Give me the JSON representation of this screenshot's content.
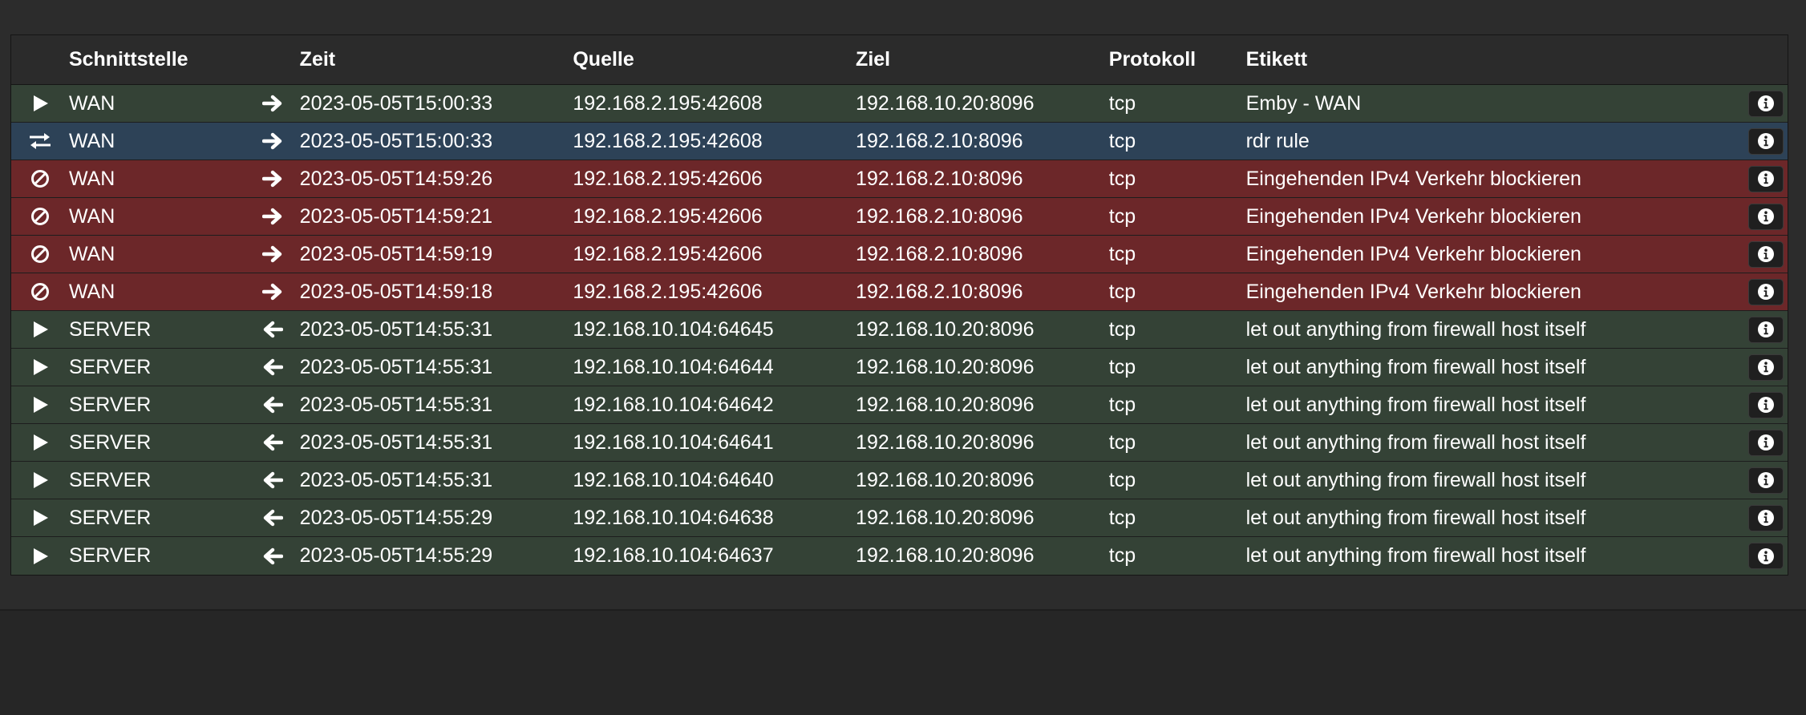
{
  "columns": {
    "interface": "Schnittstelle",
    "time": "Zeit",
    "source": "Quelle",
    "destination": "Ziel",
    "protocol": "Protokoll",
    "label": "Etikett"
  },
  "colors": {
    "pass": "#344236",
    "rdr": "#2d4257",
    "block": "#6c2729"
  },
  "rows": [
    {
      "action": "pass",
      "action_icon": "play-icon",
      "interface": "WAN",
      "direction": "in",
      "direction_icon": "arrow-right-icon",
      "time": "2023-05-05T15:00:33",
      "source": "192.168.2.195:42608",
      "destination": "192.168.10.20:8096",
      "protocol": "tcp",
      "label": "Emby - WAN"
    },
    {
      "action": "rdr",
      "action_icon": "exchange-icon",
      "interface": "WAN",
      "direction": "in",
      "direction_icon": "arrow-right-icon",
      "time": "2023-05-05T15:00:33",
      "source": "192.168.2.195:42608",
      "destination": "192.168.2.10:8096",
      "protocol": "tcp",
      "label": "rdr rule"
    },
    {
      "action": "block",
      "action_icon": "ban-icon",
      "interface": "WAN",
      "direction": "in",
      "direction_icon": "arrow-right-icon",
      "time": "2023-05-05T14:59:26",
      "source": "192.168.2.195:42606",
      "destination": "192.168.2.10:8096",
      "protocol": "tcp",
      "label": "Eingehenden IPv4 Verkehr blockieren"
    },
    {
      "action": "block",
      "action_icon": "ban-icon",
      "interface": "WAN",
      "direction": "in",
      "direction_icon": "arrow-right-icon",
      "time": "2023-05-05T14:59:21",
      "source": "192.168.2.195:42606",
      "destination": "192.168.2.10:8096",
      "protocol": "tcp",
      "label": "Eingehenden IPv4 Verkehr blockieren"
    },
    {
      "action": "block",
      "action_icon": "ban-icon",
      "interface": "WAN",
      "direction": "in",
      "direction_icon": "arrow-right-icon",
      "time": "2023-05-05T14:59:19",
      "source": "192.168.2.195:42606",
      "destination": "192.168.2.10:8096",
      "protocol": "tcp",
      "label": "Eingehenden IPv4 Verkehr blockieren"
    },
    {
      "action": "block",
      "action_icon": "ban-icon",
      "interface": "WAN",
      "direction": "in",
      "direction_icon": "arrow-right-icon",
      "time": "2023-05-05T14:59:18",
      "source": "192.168.2.195:42606",
      "destination": "192.168.2.10:8096",
      "protocol": "tcp",
      "label": "Eingehenden IPv4 Verkehr blockieren"
    },
    {
      "action": "pass",
      "action_icon": "play-icon",
      "interface": "SERVER",
      "direction": "out",
      "direction_icon": "arrow-left-icon",
      "time": "2023-05-05T14:55:31",
      "source": "192.168.10.104:64645",
      "destination": "192.168.10.20:8096",
      "protocol": "tcp",
      "label": "let out anything from firewall host itself"
    },
    {
      "action": "pass",
      "action_icon": "play-icon",
      "interface": "SERVER",
      "direction": "out",
      "direction_icon": "arrow-left-icon",
      "time": "2023-05-05T14:55:31",
      "source": "192.168.10.104:64644",
      "destination": "192.168.10.20:8096",
      "protocol": "tcp",
      "label": "let out anything from firewall host itself"
    },
    {
      "action": "pass",
      "action_icon": "play-icon",
      "interface": "SERVER",
      "direction": "out",
      "direction_icon": "arrow-left-icon",
      "time": "2023-05-05T14:55:31",
      "source": "192.168.10.104:64642",
      "destination": "192.168.10.20:8096",
      "protocol": "tcp",
      "label": "let out anything from firewall host itself"
    },
    {
      "action": "pass",
      "action_icon": "play-icon",
      "interface": "SERVER",
      "direction": "out",
      "direction_icon": "arrow-left-icon",
      "time": "2023-05-05T14:55:31",
      "source": "192.168.10.104:64641",
      "destination": "192.168.10.20:8096",
      "protocol": "tcp",
      "label": "let out anything from firewall host itself"
    },
    {
      "action": "pass",
      "action_icon": "play-icon",
      "interface": "SERVER",
      "direction": "out",
      "direction_icon": "arrow-left-icon",
      "time": "2023-05-05T14:55:31",
      "source": "192.168.10.104:64640",
      "destination": "192.168.10.20:8096",
      "protocol": "tcp",
      "label": "let out anything from firewall host itself"
    },
    {
      "action": "pass",
      "action_icon": "play-icon",
      "interface": "SERVER",
      "direction": "out",
      "direction_icon": "arrow-left-icon",
      "time": "2023-05-05T14:55:29",
      "source": "192.168.10.104:64638",
      "destination": "192.168.10.20:8096",
      "protocol": "tcp",
      "label": "let out anything from firewall host itself"
    },
    {
      "action": "pass",
      "action_icon": "play-icon",
      "interface": "SERVER",
      "direction": "out",
      "direction_icon": "arrow-left-icon",
      "time": "2023-05-05T14:55:29",
      "source": "192.168.10.104:64637",
      "destination": "192.168.10.20:8096",
      "protocol": "tcp",
      "label": "let out anything from firewall host itself"
    }
  ]
}
